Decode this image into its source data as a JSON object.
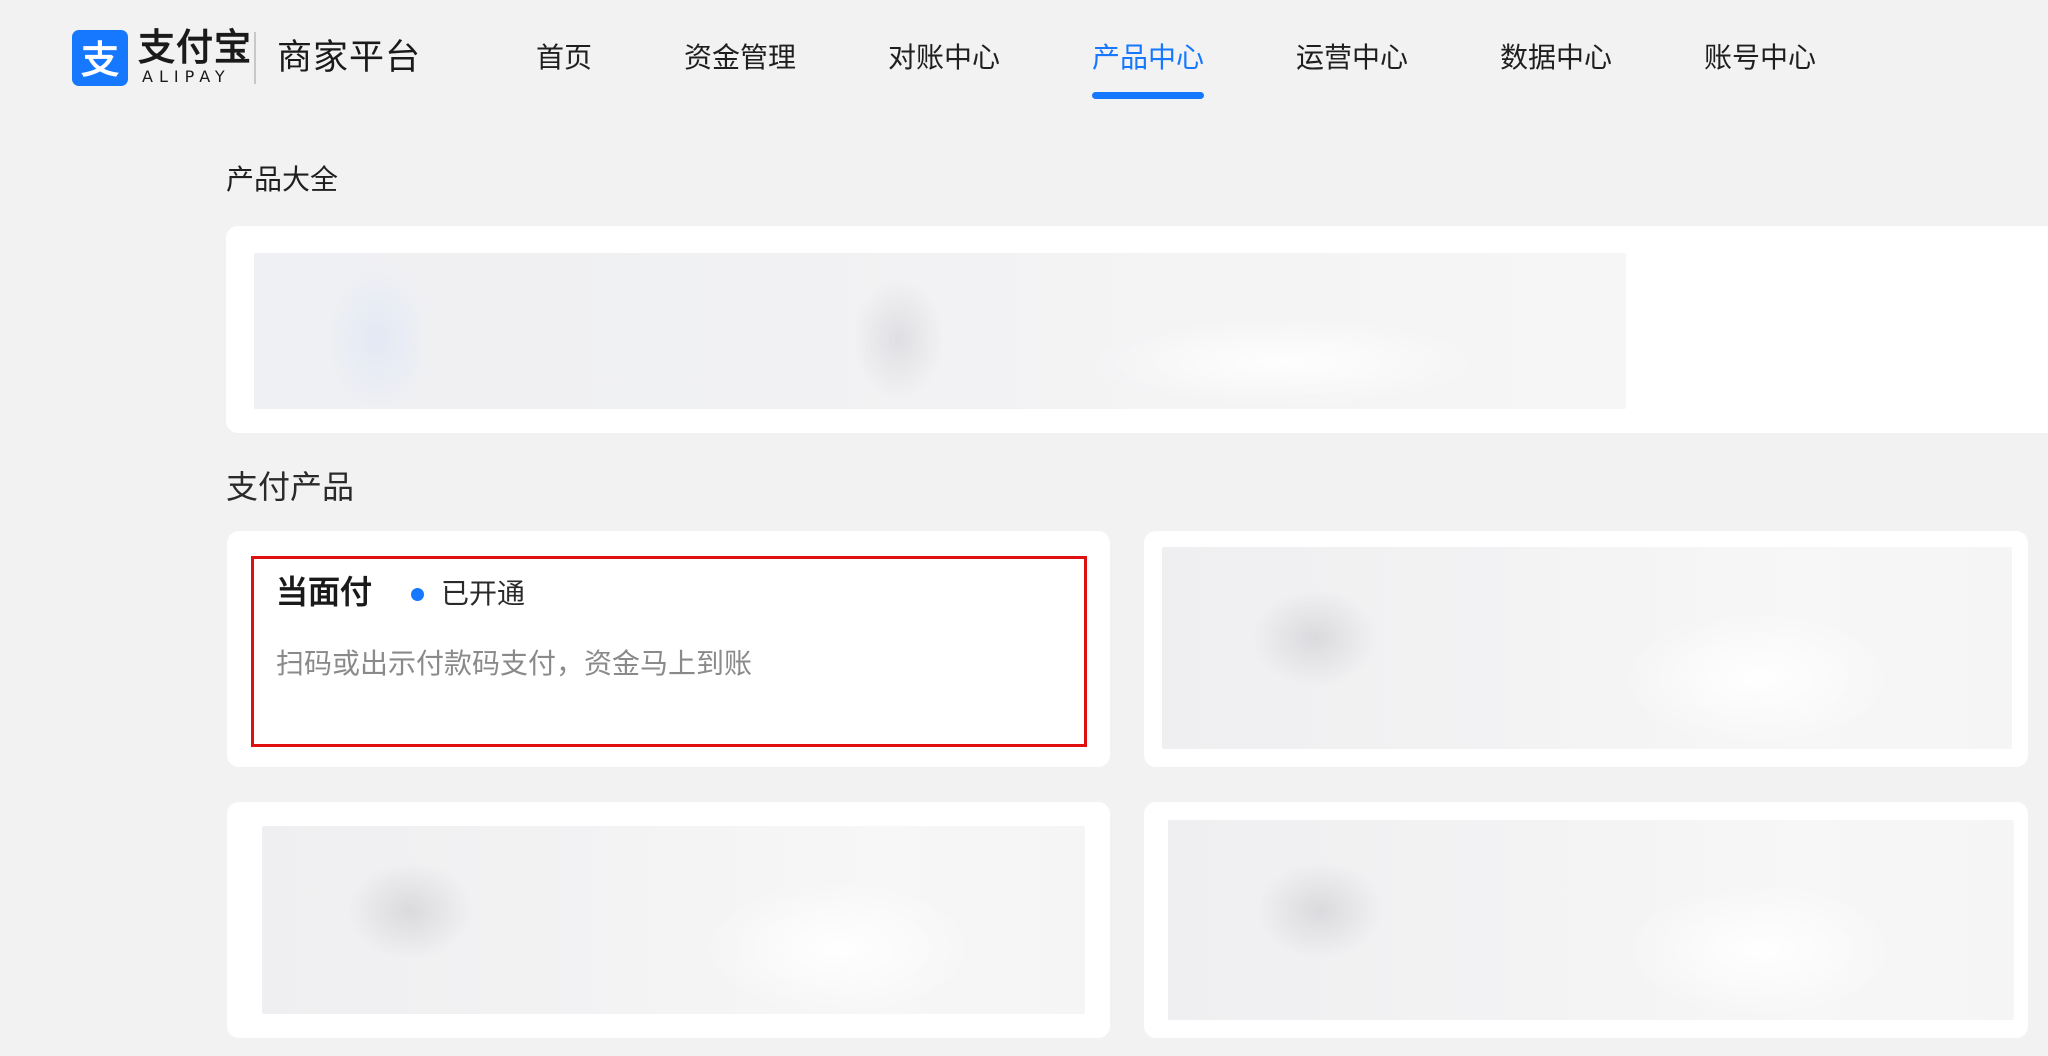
{
  "header": {
    "logo": {
      "brand_cn": "支付宝",
      "brand_en": "ALIPAY",
      "icon": "alipay-logo-icon",
      "color": "#1677ff"
    },
    "platform_name": "商家平台",
    "nav": [
      {
        "label": "首页",
        "active": false
      },
      {
        "label": "资金管理",
        "active": false
      },
      {
        "label": "对账中心",
        "active": false
      },
      {
        "label": "产品中心",
        "active": true
      },
      {
        "label": "运营中心",
        "active": false
      },
      {
        "label": "数据中心",
        "active": false
      },
      {
        "label": "账号中心",
        "active": false
      }
    ],
    "accent_color": "#1677ff"
  },
  "main": {
    "all_products_title": "产品大全",
    "payment_products_title": "支付产品",
    "products": [
      {
        "name": "当面付",
        "status": "已开通",
        "status_color": "#1677ff",
        "description": "扫码或出示付款码支付，资金马上到账",
        "highlighted": true,
        "highlight_color": "#e01010"
      }
    ]
  }
}
